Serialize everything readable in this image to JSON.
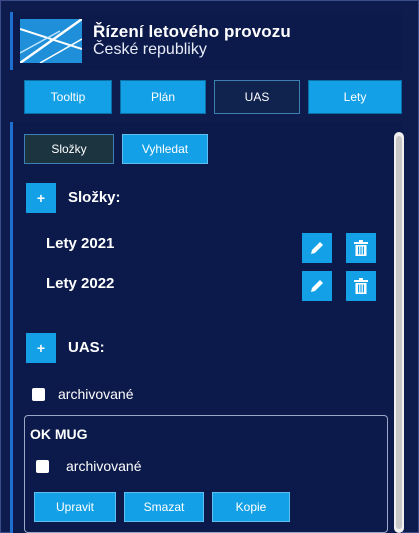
{
  "brand": {
    "line1": "Řízení letového provozu",
    "line2": "České republiky"
  },
  "tabs": [
    {
      "label": "Tooltip",
      "active": false
    },
    {
      "label": "Plán",
      "active": false
    },
    {
      "label": "UAS",
      "active": true
    },
    {
      "label": "Lety",
      "active": false
    }
  ],
  "subtabs": [
    {
      "label": "Složky",
      "active": true
    },
    {
      "label": "Vyhledat",
      "active": false
    }
  ],
  "folders": {
    "add_label": "+",
    "heading": "Složky:",
    "items": [
      {
        "name": "Lety 2021"
      },
      {
        "name": "Lety 2022"
      }
    ]
  },
  "uas": {
    "add_label": "+",
    "heading": "UAS:",
    "archived_label": "archivované",
    "card": {
      "title": "OK MUG",
      "archived_label": "archivované",
      "buttons": {
        "edit": "Upravit",
        "delete": "Smazat",
        "copy": "Kopie"
      }
    }
  },
  "colors": {
    "background": "#0d1b4d",
    "accent": "#14a0e6",
    "active_tab": "#10234f"
  }
}
